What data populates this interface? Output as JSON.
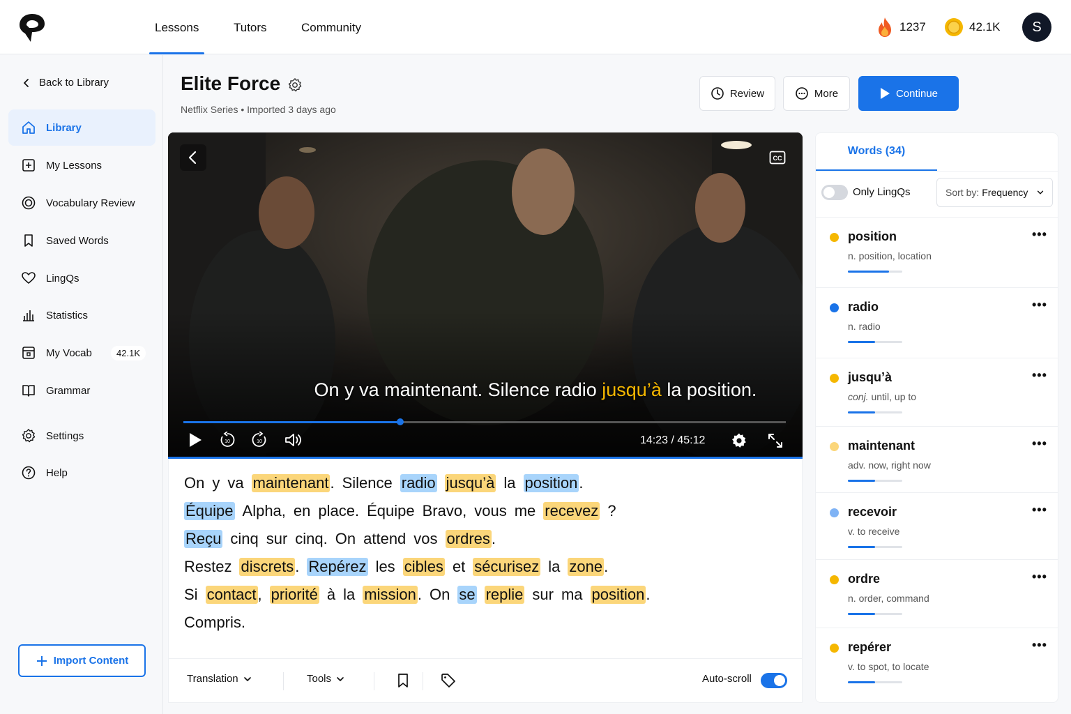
{
  "nav": {
    "tabs": [
      {
        "label": "Lessons",
        "active": true
      },
      {
        "label": "Tutors",
        "active": false
      },
      {
        "label": "Community",
        "active": false
      }
    ],
    "streak": "1237",
    "coins": "42.1K",
    "avatar_initial": "S"
  },
  "sidebar": {
    "back_label": "Back to Library",
    "items": [
      {
        "label": "Library",
        "icon": "home-icon",
        "active": true
      },
      {
        "label": "My Lessons",
        "icon": "plus-square-icon"
      },
      {
        "label": "Vocabulary Review",
        "icon": "target-icon"
      },
      {
        "label": "Saved Words",
        "icon": "bookmark-icon"
      },
      {
        "label": "LingQs",
        "icon": "heart-icon"
      },
      {
        "label": "Statistics",
        "icon": "bar-chart-icon"
      },
      {
        "label": "My Vocab",
        "icon": "vocab-box-icon",
        "badge": "42.1K"
      },
      {
        "label": "Grammar",
        "icon": "book-icon"
      },
      {
        "label": "Settings",
        "icon": "gear-icon"
      },
      {
        "label": "Help",
        "icon": "help-circle-icon"
      }
    ],
    "import_label": "Import Content"
  },
  "lesson": {
    "title": "Elite Force",
    "source": "Netflix Series",
    "imported": "Imported 3 days ago",
    "review_label": "Review",
    "more_label": "More",
    "continue_label": "Continue"
  },
  "video": {
    "subtitle_before": "On y va maintenant. Silence radio ",
    "subtitle_highlight": "jusqu’à",
    "subtitle_after": " la position.",
    "current_time": "14:23",
    "total_time": "45:12",
    "time_readout": "14:23 / 45:12",
    "progress": 0.36,
    "cc_label": "CC"
  },
  "transcript": {
    "lines": [
      [
        {
          "t": "On"
        },
        {
          "t": "y"
        },
        {
          "t": "va"
        },
        {
          "t": "maintenant",
          "h": "y",
          "p": "."
        },
        {
          "t": "Silence"
        },
        {
          "t": "radio",
          "h": "b"
        },
        {
          "t": "jusqu’à",
          "h": "y"
        },
        {
          "t": "la"
        },
        {
          "t": "position",
          "h": "b",
          "p": "."
        }
      ],
      [
        {
          "t": "Équipe",
          "h": "b"
        },
        {
          "t": "Alpha,"
        },
        {
          "t": "en"
        },
        {
          "t": "place."
        },
        {
          "t": "Équipe"
        },
        {
          "t": "Bravo,"
        },
        {
          "t": "vous"
        },
        {
          "t": "me"
        },
        {
          "t": "recevez",
          "h": "y"
        },
        {
          "t": "?"
        }
      ],
      [
        {
          "t": "Reçu",
          "h": "b"
        },
        {
          "t": "cinq"
        },
        {
          "t": "sur"
        },
        {
          "t": "cinq."
        },
        {
          "t": "On"
        },
        {
          "t": "attend"
        },
        {
          "t": "vos"
        },
        {
          "t": "ordres",
          "h": "y",
          "p": "."
        }
      ],
      [
        {
          "t": "Restez"
        },
        {
          "t": "discrets",
          "h": "y",
          "p": "."
        },
        {
          "t": "Repérez",
          "h": "b"
        },
        {
          "t": "les"
        },
        {
          "t": "cibles",
          "h": "y"
        },
        {
          "t": "et"
        },
        {
          "t": "sécurisez",
          "h": "y"
        },
        {
          "t": "la"
        },
        {
          "t": "zone",
          "h": "y",
          "p": "."
        }
      ],
      [
        {
          "t": "Si"
        },
        {
          "t": "contact",
          "h": "y",
          "p": ","
        },
        {
          "t": "priorité",
          "h": "y"
        },
        {
          "t": "à"
        },
        {
          "t": "la"
        },
        {
          "t": "mission",
          "h": "y",
          "p": "."
        },
        {
          "t": "On"
        },
        {
          "t": "se",
          "h": "b"
        },
        {
          "t": "replie",
          "h": "y"
        },
        {
          "t": "sur"
        },
        {
          "t": "ma"
        },
        {
          "t": "position",
          "h": "y",
          "p": "."
        }
      ],
      [
        {
          "t": "Compris."
        }
      ]
    ],
    "translation_label": "Translation",
    "tools_label": "Tools",
    "autoscroll_label": "Auto-scroll",
    "autoscroll_on": true
  },
  "words_panel": {
    "tab_label": "Words (34)",
    "only_lingqs_label": "Only LingQs",
    "only_lingqs_on": false,
    "sort_prefix": "Sort by:",
    "sort_value": "Frequency",
    "items": [
      {
        "word": "position",
        "pos": "n.",
        "def": "position, location",
        "dot": "#f5b700",
        "strength": 0.75
      },
      {
        "word": "radio",
        "pos": "n.",
        "def": "radio",
        "dot": "#1a73e8",
        "strength": 0.5
      },
      {
        "word": "jusqu’à",
        "pos": "conj.",
        "def": "until, up to",
        "dot": "#f5b700",
        "strength": 0.5,
        "pos_italic": true
      },
      {
        "word": "maintenant",
        "pos": "adv.",
        "def": "now, right now",
        "dot": "#fbd67a",
        "strength": 0.5
      },
      {
        "word": "recevoir",
        "pos": "v.",
        "def": "to receive",
        "dot": "#7fb3f5",
        "strength": 0.5
      },
      {
        "word": "ordre",
        "pos": "n.",
        "def": "order, command",
        "dot": "#f5b700",
        "strength": 0.5
      },
      {
        "word": "repérer",
        "pos": "v.",
        "def": "to spot, to locate",
        "dot": "#f5b700",
        "strength": 0.5
      }
    ]
  },
  "colors": {
    "accent": "#1a73e8",
    "known_yellow": "#fbd67a",
    "lingq_blue": "#a8d4fb"
  }
}
